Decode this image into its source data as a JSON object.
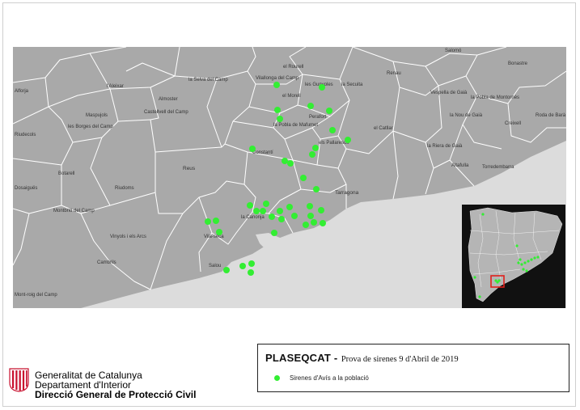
{
  "colors": {
    "land": "#a9a9a9",
    "sea": "#dcdcdc",
    "border": "#ffffff",
    "siren": "#33ee33",
    "inset_highlight": "#e0201b"
  },
  "place_labels": [
    "Alforja",
    "l'Aleixar",
    "la Selva del Camp",
    "Vilallonga del Camp",
    "el Rourell",
    "les Gunyoles",
    "la Secuita",
    "Renau",
    "Salomó",
    "Bonastre",
    "Vespella de Gaià",
    "Maspujols",
    "Almoster",
    "el Morell",
    "Perafort",
    "Castellvell del Camp",
    "la Nou de Gaià",
    "la Pobla de Montornès",
    "Roda de Barà",
    "Creixell",
    "Riudecols",
    "les Borges del Camp",
    "la Pobla de Mafumet",
    "el Catllar",
    "els Pallaresos",
    "la Riera de Gaià",
    "Altafulla",
    "Torredembarra",
    "Constantí",
    "Botarell",
    "Reus",
    "Vinyols i els Arcs",
    "Montbrió del Camp",
    "Riudoms",
    "Tarragona",
    "la Canonja",
    "Vila-seca",
    "Cambrils",
    "Salou",
    "Mont-roig del Camp",
    "Dosaiguës"
  ],
  "legend": {
    "title_bold": "PLASEQCAT -",
    "title_rest": "Prova de sirenes 9 d'Abril de 2019",
    "item_label": "Sirenes d'Avís a la població"
  },
  "org": {
    "line1": "Generalitat de Catalunya",
    "line2": "Departament d'Interior",
    "line3": "Direcció General de Protecció Civil"
  }
}
